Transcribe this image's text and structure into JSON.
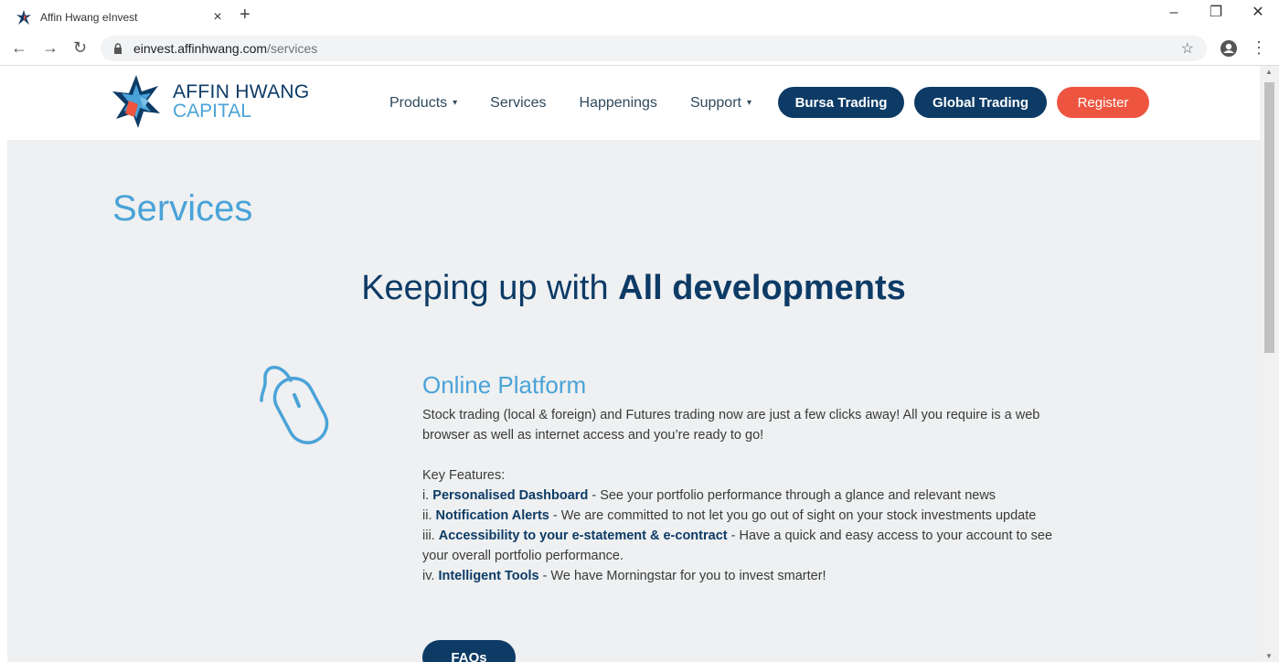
{
  "browser": {
    "tab_title": "Affin Hwang eInvest",
    "tab_close": "×",
    "new_tab": "+",
    "url_host": "einvest.affinhwang.com",
    "url_path": "/services",
    "win_min": "–",
    "win_restore": "❐",
    "win_close": "✕"
  },
  "header": {
    "logo_line1": "AFFIN HWANG",
    "logo_line2": "CAPITAL",
    "nav": {
      "products": "Products",
      "services": "Services",
      "happenings": "Happenings",
      "support": "Support"
    },
    "buttons": {
      "bursa": "Bursa Trading",
      "global": "Global Trading",
      "register": "Register"
    }
  },
  "main": {
    "page_title": "Services",
    "headline_light": "Keeping up with ",
    "headline_bold": "All developments",
    "section": {
      "title": "Online Platform",
      "intro": "Stock trading (local & foreign) and Futures trading now are just a few clicks away! All you require is a web browser as well as internet access and you’re ready to go!",
      "key_features_label": "Key Features:",
      "features": [
        {
          "prefix": "i. ",
          "bold": "Personalised Dashboard",
          "rest": " - See your portfolio performance through a glance and relevant news"
        },
        {
          "prefix": "ii. ",
          "bold": "Notification Alerts",
          "rest": " - We are committed to not let you go out of sight on your stock investments update"
        },
        {
          "prefix": "iii. ",
          "bold": "Accessibility to your e-statement & e-contract",
          "rest": " - Have a quick and easy access to your account to see your overall portfolio performance."
        },
        {
          "prefix": "iv. ",
          "bold": "Intelligent Tools",
          "rest": " - We have Morningstar for you to invest smarter!"
        }
      ]
    },
    "faq_button": "FAQs"
  },
  "colors": {
    "navy": "#0d3b66",
    "sky": "#4aa3d8",
    "red": "#ee5540",
    "page_bg": "#eef0f1"
  }
}
